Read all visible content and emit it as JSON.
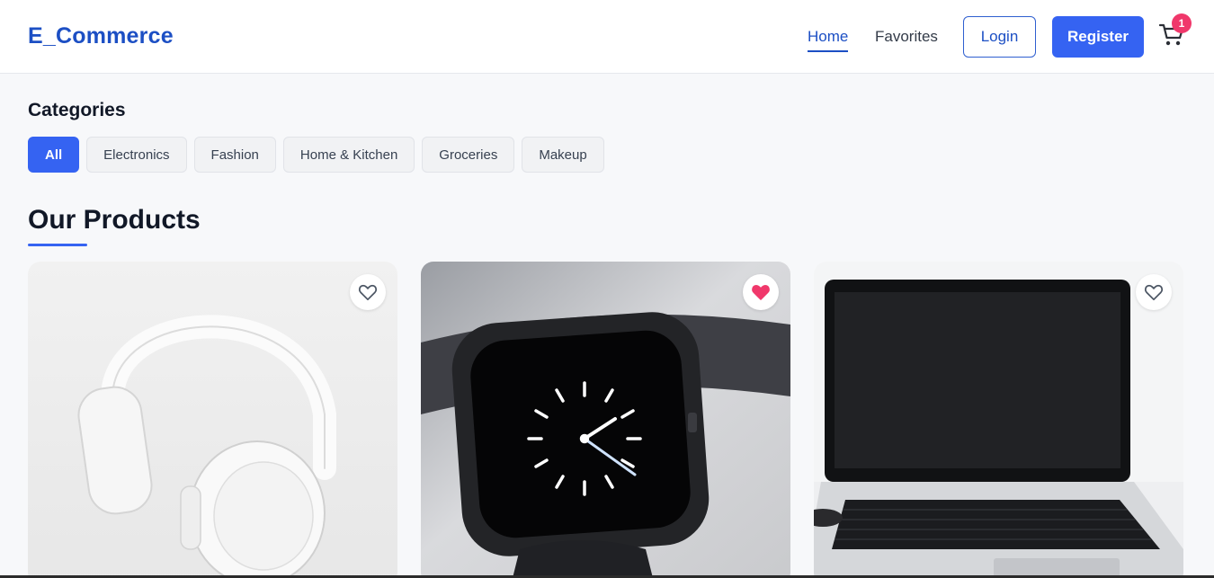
{
  "header": {
    "brand": "E_Commerce",
    "nav": [
      {
        "label": "Home",
        "active": true
      },
      {
        "label": "Favorites",
        "active": false
      }
    ],
    "login_label": "Login",
    "register_label": "Register",
    "cart_count": "1",
    "cart_icon": "cart-icon"
  },
  "categories": {
    "title": "Categories",
    "items": [
      "All",
      "Electronics",
      "Fashion",
      "Home & Kitchen",
      "Groceries",
      "Makeup"
    ],
    "active": "All"
  },
  "products": {
    "title": "Our Products",
    "items": [
      {
        "image": "white headphones",
        "favorited": false
      },
      {
        "image": "black smartwatch",
        "favorited": true
      },
      {
        "image": "silver laptop",
        "favorited": false
      }
    ]
  },
  "colors": {
    "brand": "#1c4fc4",
    "primary": "#3563f2",
    "favorite": "#f0386b"
  }
}
